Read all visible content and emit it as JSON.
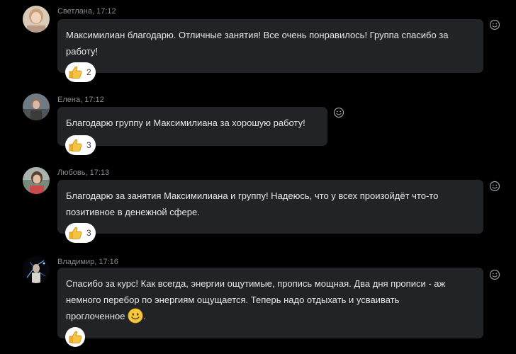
{
  "messages": [
    {
      "author": "Светлана",
      "time": "17:12",
      "text_lines": [
        "Максимилиан благодарю. Отличные занятия! Все очень понравилось! Группа спасибо за",
        "работу!"
      ],
      "reaction_count": "2"
    },
    {
      "author": "Елена",
      "time": "17:12",
      "text_lines": [
        "Благодарю группу  и Максимилиана за хорошую работу!"
      ],
      "reaction_count": "3"
    },
    {
      "author": "Любовь",
      "time": "17:13",
      "text_lines": [
        "Благодарю за занятия Максимилиана и группу! Надеюсь, что у всех произойдёт что-то",
        "позитивное в денежной сфере."
      ],
      "reaction_count": "3"
    },
    {
      "author": "Владимир",
      "time": "17:16",
      "text_lines": [
        "Спасибо за курс! Как всегда, энергии ощутимые, пропись мощная. Два дня прописи - аж",
        "немного перебор по энергиям ощущается. Теперь надо отдыхать и усваивать",
        "проглоченное"
      ],
      "text_tail": ".",
      "reaction_count": ""
    }
  ],
  "icons": {
    "reaction": "thumbs-up-icon",
    "add_reaction": "smile-icon",
    "inline_emoji": "smiley-emoji-icon"
  },
  "colors": {
    "background": "#000000",
    "bubble": "#222326",
    "text": "#e8e8e8",
    "meta": "#8a8d92",
    "reaction_pill": "#ffffff"
  }
}
